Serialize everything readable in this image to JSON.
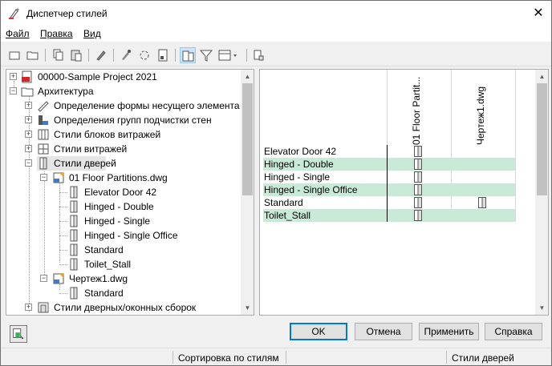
{
  "window": {
    "title": "Диспетчер стилей",
    "close_glyph": "✕"
  },
  "menu": {
    "file": "Файл",
    "edit": "Правка",
    "view": "Вид"
  },
  "tree": {
    "project": "00000-Sample Project 2021",
    "architecture": "Архитектура",
    "items": [
      "Определение формы несущего элемента",
      "Определения групп подчистки стен",
      "Стили блоков витражей",
      "Стили витражей",
      "Стили дверей"
    ],
    "file1": "01 Floor Partitions.dwg",
    "file1_children": [
      "Elevator Door 42",
      "Hinged - Double",
      "Hinged - Single",
      "Hinged - Single Office",
      "Standard",
      "Toilet_Stall"
    ],
    "file2": "Чертеж1.dwg",
    "file2_children": [
      "Standard"
    ],
    "last_item": "Стили дверных/оконных сборок"
  },
  "matrix": {
    "columns": [
      "01 Floor Partit...",
      "Чертеж1.dwg"
    ],
    "rows": [
      {
        "name": "Elevator Door 42",
        "highlight": false,
        "in_col1": true,
        "in_col2": false
      },
      {
        "name": "Hinged - Double",
        "highlight": true,
        "in_col1": true,
        "in_col2": false
      },
      {
        "name": "Hinged - Single",
        "highlight": false,
        "in_col1": true,
        "in_col2": false
      },
      {
        "name": "Hinged - Single Office",
        "highlight": true,
        "in_col1": true,
        "in_col2": false
      },
      {
        "name": "Standard",
        "highlight": false,
        "in_col1": true,
        "in_col2": true
      },
      {
        "name": "Toilet_Stall",
        "highlight": true,
        "in_col1": true,
        "in_col2": false
      }
    ],
    "highlight_color": "#c9ead9"
  },
  "buttons": {
    "ok": "OK",
    "cancel": "Отмена",
    "apply": "Применить",
    "help": "Справка"
  },
  "status": {
    "sort": "Сортировка по стилям",
    "context": "Стили дверей"
  }
}
